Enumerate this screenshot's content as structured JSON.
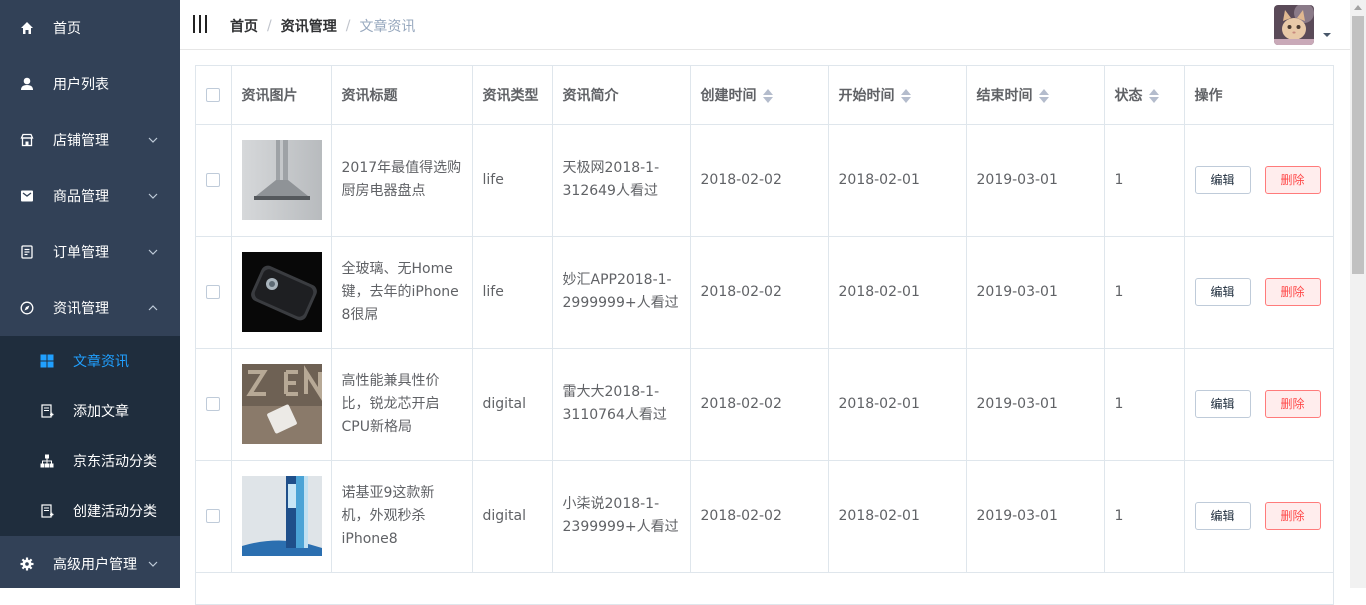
{
  "sidebar": {
    "items": [
      {
        "label": "首页"
      },
      {
        "label": "用户列表"
      },
      {
        "label": "店铺管理"
      },
      {
        "label": "商品管理"
      },
      {
        "label": "订单管理"
      },
      {
        "label": "资讯管理"
      },
      {
        "label": "高级用户管理"
      }
    ],
    "submenu": [
      {
        "label": "文章资讯",
        "active": true
      },
      {
        "label": "添加文章"
      },
      {
        "label": "京东活动分类"
      },
      {
        "label": "创建活动分类"
      }
    ],
    "active_color": "#20a0ff",
    "bg_color": "#324157",
    "submenu_bg": "#1f2d3d"
  },
  "header": {
    "breadcrumb": [
      "首页",
      "资讯管理",
      "文章资讯"
    ],
    "separator": "/"
  },
  "table": {
    "columns": [
      "资讯图片",
      "资讯标题",
      "资讯类型",
      "资讯简介",
      "创建时间",
      "开始时间",
      "结束时间",
      "状态",
      "操作"
    ],
    "edit_label": "编辑",
    "delete_label": "删除",
    "rows": [
      {
        "title": "2017年最值得选购厨房电器盘点",
        "type": "life",
        "intro": "天极网2018-1-312649人看过",
        "created": "2018-02-02",
        "start": "2018-02-01",
        "end": "2019-03-01",
        "status": "1"
      },
      {
        "title": "全玻璃、无Home键，去年的iPhone 8很屌",
        "type": "life",
        "intro": "妙汇APP2018-1-2999999+人看过",
        "created": "2018-02-02",
        "start": "2018-02-01",
        "end": "2019-03-01",
        "status": "1"
      },
      {
        "title": "高性能兼具性价比，锐龙芯开启CPU新格局",
        "type": "digital",
        "intro": "雷大大2018-1-3110764人看过",
        "created": "2018-02-02",
        "start": "2018-02-01",
        "end": "2019-03-01",
        "status": "1"
      },
      {
        "title": "诺基亚9这款新机，外观秒杀iPhone8",
        "type": "digital",
        "intro": "小柒说2018-1-2399999+人看过",
        "created": "2018-02-02",
        "start": "2018-02-01",
        "end": "2019-03-01",
        "status": "1"
      }
    ]
  }
}
